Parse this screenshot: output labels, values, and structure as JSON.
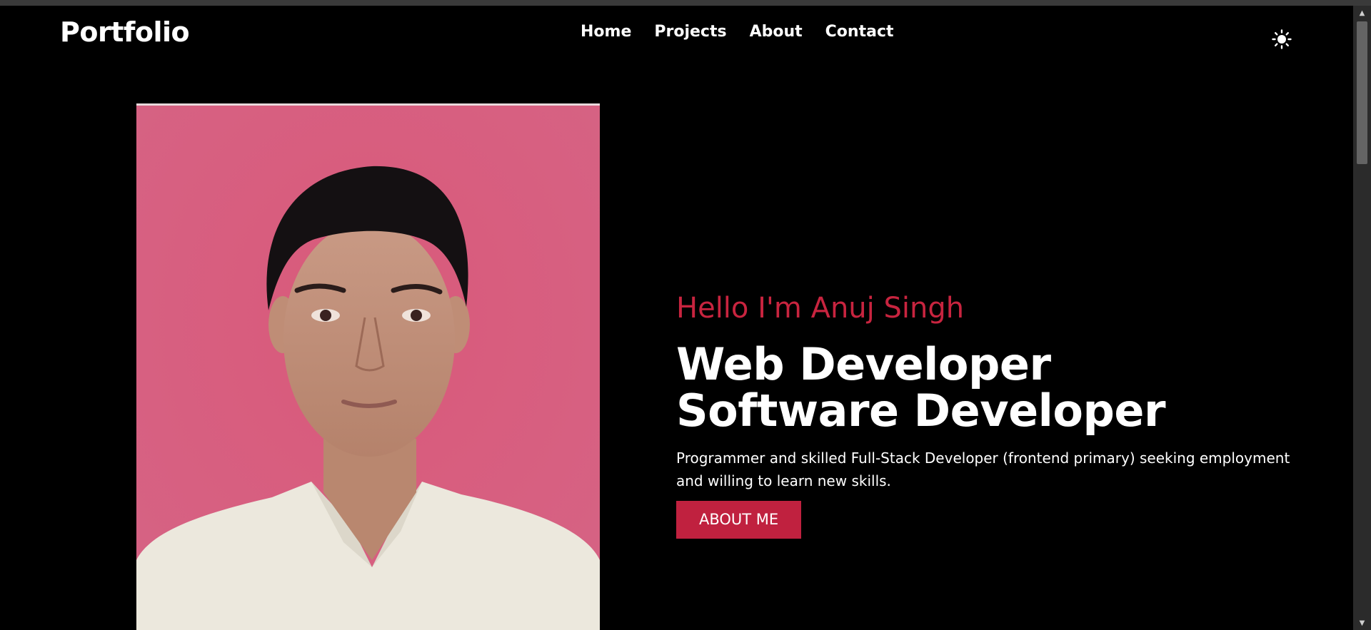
{
  "nav": {
    "brand": "Portfolio",
    "links": [
      "Home",
      "Projects",
      "About",
      "Contact"
    ],
    "theme_icon": "sun-icon"
  },
  "hero": {
    "greeting": "Hello I'm Anuj Singh",
    "title_line1": "Web Developer",
    "title_line2": "Software Developer",
    "description": "Programmer and skilled Full-Stack Developer (frontend primary) seeking employment and willing to learn new skills.",
    "button_label": "ABOUT ME"
  },
  "colors": {
    "background": "#000000",
    "accent": "#c0213f",
    "text": "#ffffff",
    "photo_background": "#d45f80"
  }
}
